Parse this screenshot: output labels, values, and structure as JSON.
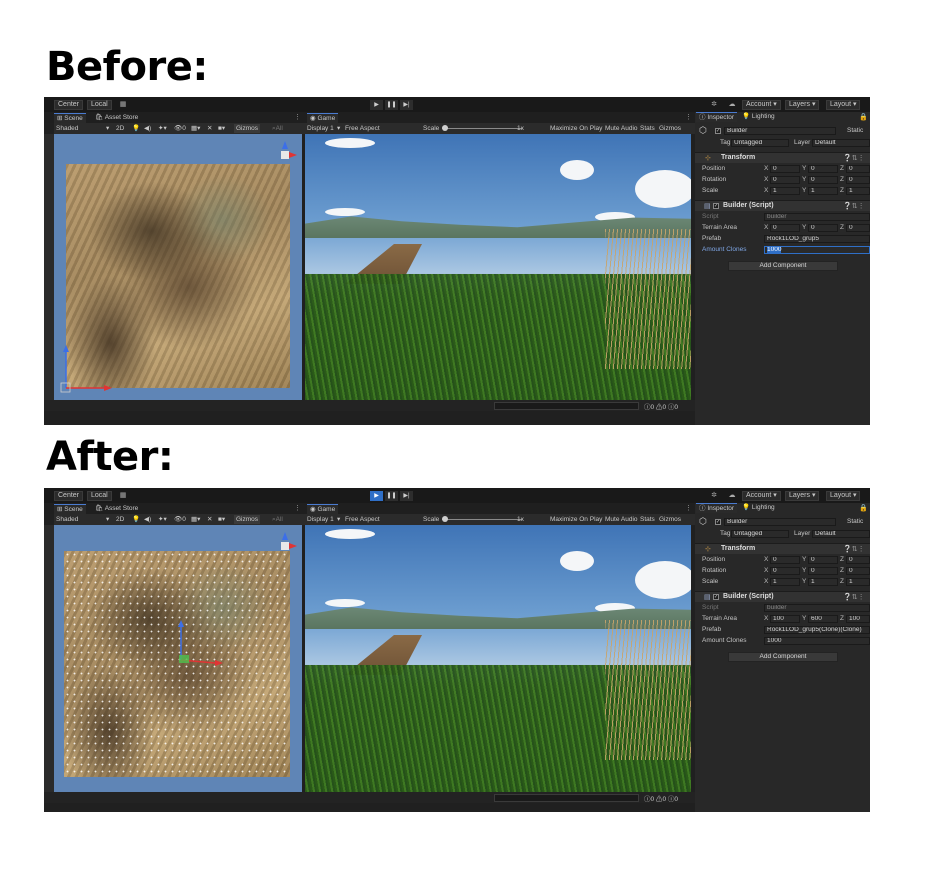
{
  "headings": {
    "before": "Before:",
    "after": "After:"
  },
  "colors": {
    "accent": "#2f6fc7",
    "editor_bg": "#202020",
    "inspector_bg": "#282828",
    "selected_field": "#2f6fc7"
  },
  "toolbar": {
    "center": "Center",
    "local": "Local",
    "account": "Account ▾",
    "layers": "Layers ▾",
    "layout": "Layout ▾",
    "play_icon": "play-icon",
    "pause_icon": "pause-icon",
    "step_icon": "step-icon",
    "play_glyph": "▶",
    "pause_glyph": "❚❚",
    "step_glyph": "▶|"
  },
  "tabs": {
    "scene": "Scene",
    "asset_store": "Asset Store",
    "game": "Game",
    "inspector": "Inspector",
    "lighting": "Lighting"
  },
  "scene_toolbar": {
    "shading": "Shaded",
    "mode_2d": "2D",
    "gizmos": "Gizmos"
  },
  "game_toolbar": {
    "display": "Display 1",
    "aspect": "Free Aspect",
    "scale_label": "Scale",
    "scale_value": "1x",
    "maximize": "Maximize On Play",
    "mute": "Mute Audio",
    "stats": "Stats",
    "gizmos": "Gizmos"
  },
  "status": {
    "errors": "0",
    "warnings": "0",
    "messages": "0"
  },
  "inspector": {
    "object_name": "Builder",
    "static_label": "Static",
    "tag_label": "Tag",
    "tag_value": "Untagged",
    "layer_label": "Layer",
    "layer_value": "Default",
    "transform_title": "Transform",
    "position_label": "Position",
    "rotation_label": "Rotation",
    "scale_label": "Scale",
    "builder_title": "Builder (Script)",
    "script_label": "Script",
    "script_value": "builder",
    "terrain_label": "Terrain Area",
    "prefab_label": "Prefab",
    "amount_label": "Amount Clones",
    "add_component": "Add Component"
  },
  "before": {
    "position": {
      "x": "0",
      "y": "0",
      "z": "0"
    },
    "rotation": {
      "x": "0",
      "y": "0",
      "z": "0"
    },
    "scale": {
      "x": "1",
      "y": "1",
      "z": "1"
    },
    "terrain": {
      "x": "0",
      "y": "0",
      "z": "0"
    },
    "prefab": "Rock1LOD_grup5",
    "amount": "1000"
  },
  "after": {
    "position": {
      "x": "0",
      "y": "0",
      "z": "0"
    },
    "rotation": {
      "x": "0",
      "y": "0",
      "z": "0"
    },
    "scale": {
      "x": "1",
      "y": "1",
      "z": "1"
    },
    "terrain": {
      "x": "100",
      "y": "600",
      "z": "100"
    },
    "prefab": "Rock1LOD_grup5(Clone)(Clone)",
    "amount": "1000"
  }
}
